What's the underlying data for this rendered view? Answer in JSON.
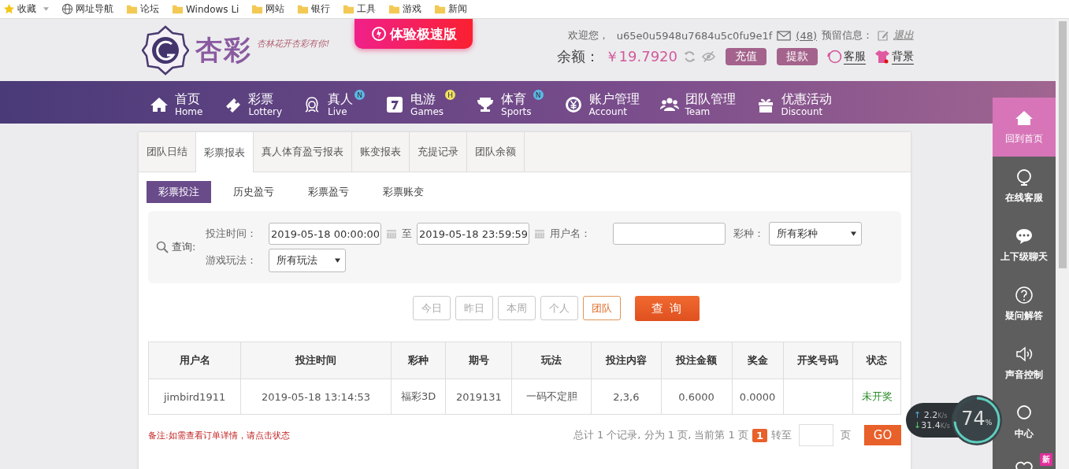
{
  "bookmarks": [
    {
      "label": "收藏",
      "kind": "star",
      "menu": true
    },
    {
      "label": "网址导航",
      "kind": "globe",
      "menu": false
    },
    {
      "label": "论坛",
      "kind": "folder",
      "menu": false
    },
    {
      "label": "Windows Li",
      "kind": "folder",
      "menu": false
    },
    {
      "label": "网站",
      "kind": "folder",
      "menu": false
    },
    {
      "label": "银行",
      "kind": "folder",
      "menu": false
    },
    {
      "label": "工具",
      "kind": "folder",
      "menu": false
    },
    {
      "label": "游戏",
      "kind": "folder",
      "menu": false
    },
    {
      "label": "新闻",
      "kind": "folder",
      "menu": false
    }
  ],
  "header": {
    "logo_text": "杏彩",
    "slogan": "杏林花开杏彩有你!",
    "promo": "体验极速版",
    "welcome": "欢迎您，",
    "username": "u65e0u5948u7684u5c0fu9e1f",
    "mail_count": "(48)",
    "reserved_label": "预留信息：",
    "logout": "退出",
    "balance_label": "余额：",
    "balance": "￥19.7920",
    "buttons": [
      "充值",
      "提款"
    ],
    "links": [
      "客服",
      "背景"
    ]
  },
  "nav": [
    {
      "zh": "首页",
      "en": "Home"
    },
    {
      "zh": "彩票",
      "en": "Lottery"
    },
    {
      "zh": "真人",
      "en": "Live",
      "badge": "N",
      "color": "#5bb8e8"
    },
    {
      "zh": "电游",
      "en": "Games",
      "badge": "H",
      "color": "#f0e060"
    },
    {
      "zh": "体育",
      "en": "Sports",
      "badge": "N",
      "color": "#5bb8e8"
    },
    {
      "zh": "账户管理",
      "en": "Account"
    },
    {
      "zh": "团队管理",
      "en": "Team"
    },
    {
      "zh": "优惠活动",
      "en": "Discount"
    }
  ],
  "tabs": [
    {
      "label": "团队日结",
      "selected": false
    },
    {
      "label": "彩票报表",
      "selected": true
    },
    {
      "label": "真人体育盈亏报表",
      "selected": false
    },
    {
      "label": "账变报表",
      "selected": false
    },
    {
      "label": "充提记录",
      "selected": false
    },
    {
      "label": "团队余额",
      "selected": false
    }
  ],
  "subtabs": [
    {
      "label": "彩票投注",
      "selected": true
    },
    {
      "label": "历史盈亏",
      "selected": false
    },
    {
      "label": "彩票盈亏",
      "selected": false
    },
    {
      "label": "彩票账变",
      "selected": false
    }
  ],
  "filter": {
    "query_label": "查询:",
    "time_label": "投注时间：",
    "start": "2019-05-18 00:00:00",
    "to": "至",
    "end": "2019-05-18 23:59:59",
    "user_label": "用户名：",
    "lottery_label": "彩种：",
    "lottery": "所有彩种",
    "play_label": "游戏玩法：",
    "play": "所有玩法"
  },
  "quick": [
    {
      "label": "今日",
      "selected": false
    },
    {
      "label": "昨日",
      "selected": false
    },
    {
      "label": "本周",
      "selected": false
    },
    {
      "label": "个人",
      "selected": false
    },
    {
      "label": "团队",
      "selected": true
    }
  ],
  "search_button": "查 询",
  "table": {
    "columns": [
      "用户名",
      "投注时间",
      "彩种",
      "期号",
      "玩法",
      "投注内容",
      "投注金额",
      "奖金",
      "开奖号码",
      "状态"
    ],
    "rows": [
      {
        "cells": [
          "jimbird1911",
          "2019-05-18 13:14:53",
          "福彩3D",
          "2019131",
          "一码不定胆",
          "2,3,6",
          "0.6000",
          "0.0000",
          ""
        ],
        "status": "未开奖"
      }
    ]
  },
  "note": "备注:如需查看订单详情，请点击状态",
  "pager": {
    "summary": "总计 1 个记录, 分为 1 页, 当前第 1 页",
    "current": "1",
    "goto": "转至",
    "page": "页",
    "go": "GO"
  },
  "sidebar": [
    {
      "label": "回到首页",
      "selected": true
    },
    {
      "label": "在线客服",
      "selected": false
    },
    {
      "label": "上下级聊天",
      "selected": false
    },
    {
      "label": "疑问解答",
      "selected": false
    },
    {
      "label": "声音控制",
      "selected": false
    },
    {
      "label": "中心",
      "selected": false
    },
    {
      "badge": "新",
      "selected": false
    }
  ],
  "speed": {
    "up_arrow": "↑",
    "up": "2.2",
    "up_unit": "K/s",
    "down_arrow": "↓",
    "down": "31.4",
    "down_unit": "K/s",
    "percent": "74",
    "percent_sign": "%"
  }
}
